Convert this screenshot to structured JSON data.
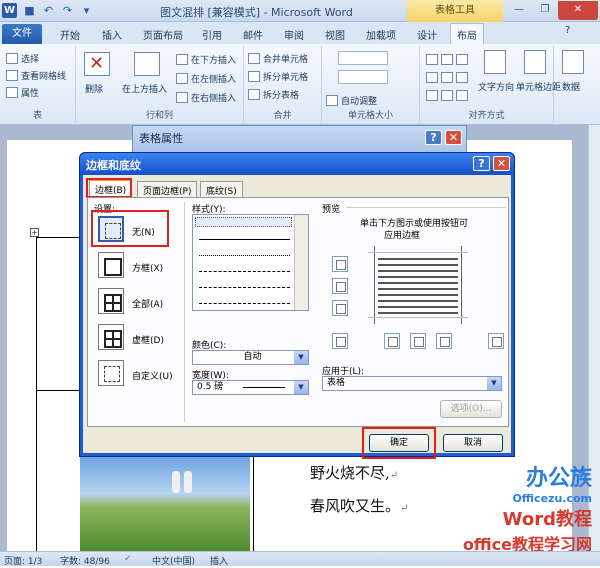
{
  "app": {
    "window_title": "图文混排 [兼容模式] - Microsoft Word",
    "context_tools": "表格工具"
  },
  "tabs": {
    "file": "文件",
    "items": [
      "开始",
      "插入",
      "页面布局",
      "引用",
      "邮件",
      "审阅",
      "视图",
      "加载项",
      "设计",
      "布局"
    ],
    "active": "布局"
  },
  "ribbon": {
    "table_group": {
      "select": "选择",
      "gridlines": "查看网格线",
      "properties": "属性",
      "label": "表"
    },
    "rows_group": {
      "delete": "删除",
      "insert_above": "在上方插入",
      "insert_below": "在下方插入",
      "insert_left": "在左侧插入",
      "insert_right": "在右侧插入",
      "label": "行和列"
    },
    "merge_group": {
      "merge": "合并单元格",
      "split_cells": "拆分单元格",
      "split_table": "拆分表格",
      "label": "合并"
    },
    "size_group": {
      "autofit": "自动调整",
      "label": "单元格大小"
    },
    "align_group": {
      "direction": "文字方向",
      "margins": "单元格边距",
      "label": "对齐方式"
    },
    "data_group": {
      "data": "数据"
    }
  },
  "back_dialog": {
    "title": "表格属性",
    "help": "?",
    "close": "✕"
  },
  "dialog": {
    "title": "边框和底纹",
    "help": "?",
    "close": "✕",
    "tabs": [
      "边框(B)",
      "页面边框(P)",
      "底纹(S)"
    ],
    "settings_label": "设置:",
    "settings": [
      "无(N)",
      "方框(X)",
      "全部(A)",
      "虚框(D)",
      "自定义(U)"
    ],
    "style_label": "样式(Y):",
    "color_label": "颜色(C):",
    "color_value": "自动",
    "width_label": "宽度(W):",
    "width_value": "0.5 磅",
    "preview_label": "预览",
    "preview_hint_line1": "单击下方图示或使用按钮可",
    "preview_hint_line2": "应用边框",
    "apply_label": "应用于(L):",
    "apply_value": "表格",
    "options_button": "选项(O)...",
    "ok_button": "确定",
    "cancel_button": "取消"
  },
  "document": {
    "poem_line1": "野火烧不尽,",
    "poem_line2": "春风吹又生。",
    "para_mark": "↵"
  },
  "watermark": {
    "brand_cn": "办公族",
    "brand_url": "Officezu.com",
    "brand_word": "Word教程",
    "site_cn": "office教程学习网",
    "site_url": "www.office68.com"
  },
  "status": {
    "page": "页面: 1/3",
    "words": "字数: 48/96",
    "language": "中文(中国)",
    "mode": "插入"
  },
  "colors": {
    "accent": "#1f5dd4",
    "highlight": "#e01f1f",
    "file_tab": "#2a63b5",
    "context": "#f5d36a"
  }
}
